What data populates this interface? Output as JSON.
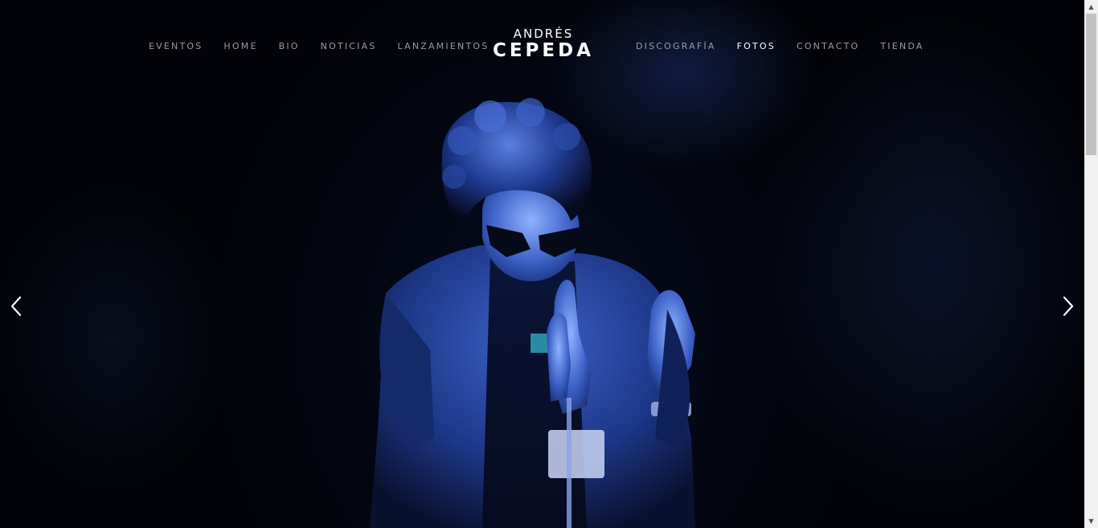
{
  "nav_left": [
    {
      "label": "EVENTOS"
    },
    {
      "label": "HOME"
    },
    {
      "label": "BIO"
    },
    {
      "label": "NOTICIAS"
    },
    {
      "label": "LANZAMIENTOS"
    }
  ],
  "nav_right": [
    {
      "label": "DISCOGRAFÍA"
    },
    {
      "label": "FOTOS",
      "active": true
    },
    {
      "label": "CONTACTO"
    },
    {
      "label": "TIENDA"
    }
  ],
  "logo": {
    "line1": "ANDRÉS",
    "line2": "CEPEDA"
  },
  "slider": {
    "prev_icon": "chevron-left-icon",
    "next_icon": "chevron-right-icon"
  },
  "colors": {
    "background": "#020308",
    "nav_text": "#9a9aa2",
    "nav_active": "#ffffff",
    "photo_tint": "#2a4fb0"
  },
  "scrollbar": {
    "up_icon": "scroll-up-arrow-icon",
    "down_icon": "scroll-down-arrow-icon"
  }
}
